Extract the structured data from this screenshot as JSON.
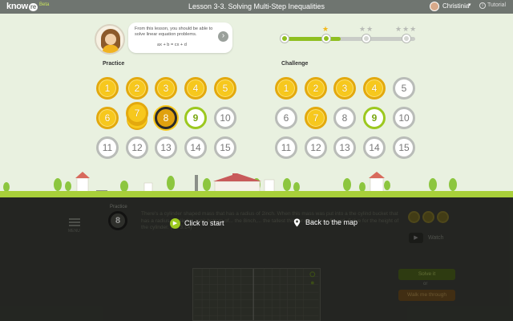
{
  "header": {
    "logo": "know",
    "logo_re": "re",
    "beta": "Beta",
    "lesson_title": "Lesson 3-3. Solving Multi-Step Inequalities",
    "user_name": "Christinia",
    "user_caret": "▾",
    "tutorial_icon": "i",
    "tutorial": "Tutorial"
  },
  "intro": {
    "text": "From this lesson, you should be able to solve linear equation problems.",
    "equation": "ax + b = cx + d",
    "arrow_icon": "›"
  },
  "progress": {
    "fraction": 0.44,
    "stars": [
      "★",
      "★★",
      "★★★"
    ]
  },
  "practice": {
    "label": "Practice",
    "coins": [
      {
        "n": "1",
        "state": "gold"
      },
      {
        "n": "2",
        "state": "gold"
      },
      {
        "n": "3",
        "state": "gold"
      },
      {
        "n": "4",
        "state": "gold"
      },
      {
        "n": "5",
        "state": "gold"
      },
      {
        "n": "6",
        "state": "gold"
      },
      {
        "n": "7",
        "state": "stack"
      },
      {
        "n": "8",
        "state": "dark"
      },
      {
        "n": "9",
        "state": "green"
      },
      {
        "n": "10",
        "state": "empty"
      },
      {
        "n": "11",
        "state": "empty"
      },
      {
        "n": "12",
        "state": "empty"
      },
      {
        "n": "13",
        "state": "empty"
      },
      {
        "n": "14",
        "state": "empty"
      },
      {
        "n": "15",
        "state": "empty"
      }
    ]
  },
  "challenge": {
    "label": "Challenge",
    "coins": [
      {
        "n": "1",
        "state": "gold"
      },
      {
        "n": "2",
        "state": "gold"
      },
      {
        "n": "3",
        "state": "gold"
      },
      {
        "n": "4",
        "state": "gold"
      },
      {
        "n": "5",
        "state": "empty"
      },
      {
        "n": "6",
        "state": "empty"
      },
      {
        "n": "7",
        "state": "gold"
      },
      {
        "n": "8",
        "state": "empty"
      },
      {
        "n": "9",
        "state": "green"
      },
      {
        "n": "10",
        "state": "empty"
      },
      {
        "n": "11",
        "state": "empty"
      },
      {
        "n": "12",
        "state": "empty"
      },
      {
        "n": "13",
        "state": "empty"
      },
      {
        "n": "14",
        "state": "empty"
      },
      {
        "n": "15",
        "state": "empty"
      }
    ]
  },
  "problem": {
    "menu_label": "MENU",
    "practice_label": "Practice",
    "practice_number": "8",
    "question": "There's a cylinder shaped mass that has a radius of 2inch. When this mass was put into a the cylind bucket that has a radius... cylinder sank bottom of... the 8inch,... the tallest thinder water over flowed. Solve for the height of the cylinder. (π : 3.14)",
    "click_to_start": "Click to start",
    "play_icon": "▶",
    "back_to_map": "Back to the map",
    "watch": "Watch",
    "video_icon": "▶",
    "solve_it": "Solve it",
    "or": "or",
    "walk_me_through": "Walk me through"
  },
  "colors": {
    "accent_green": "#8fbf21",
    "coin_gold": "#f7c81d",
    "topbar": "#6f7570"
  }
}
